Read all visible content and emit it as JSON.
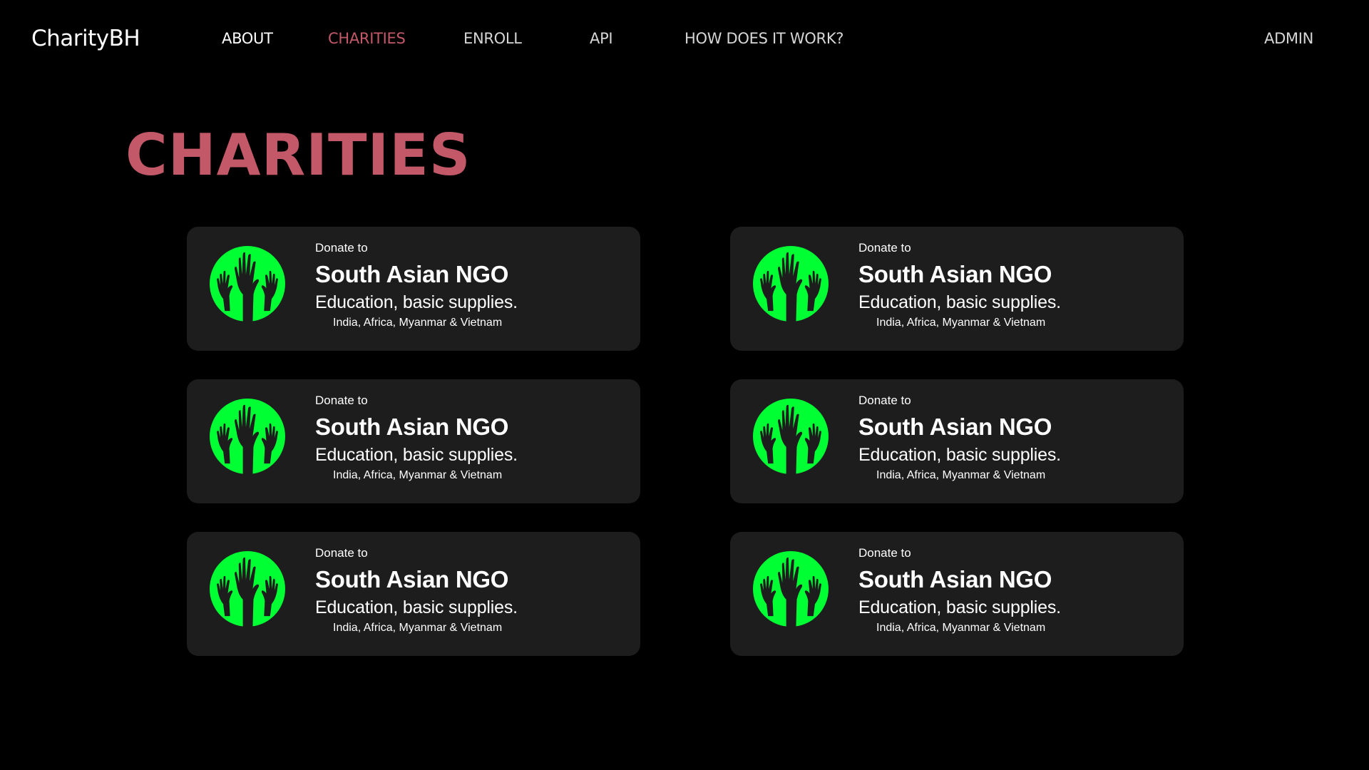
{
  "header": {
    "brand": "CharityBH",
    "nav": [
      {
        "label": "ABOUT"
      },
      {
        "label": "CHARITIES"
      },
      {
        "label": "ENROLL"
      },
      {
        "label": "API"
      },
      {
        "label": "HOW DOES IT WORK?"
      }
    ],
    "admin_label": "ADMIN",
    "active_item": "CHARITIES"
  },
  "page": {
    "title": "CHARITIES"
  },
  "colors": {
    "background": "#000000",
    "accent": "#c25868",
    "card_background": "#1d1d1d",
    "logo_green": "#00ff33"
  },
  "charities": [
    {
      "icon": "raised-hands-icon",
      "donate_label": "Donate to",
      "name": "South Asian NGO",
      "cause": "Education, basic supplies.",
      "regions": "India, Africa, Myanmar & Vietnam"
    },
    {
      "icon": "raised-hands-icon",
      "donate_label": "Donate to",
      "name": "South Asian NGO",
      "cause": "Education, basic supplies.",
      "regions": "India, Africa, Myanmar & Vietnam"
    },
    {
      "icon": "raised-hands-icon",
      "donate_label": "Donate to",
      "name": "South Asian NGO",
      "cause": "Education, basic supplies.",
      "regions": "India, Africa, Myanmar & Vietnam"
    },
    {
      "icon": "raised-hands-icon",
      "donate_label": "Donate to",
      "name": "South Asian NGO",
      "cause": "Education, basic supplies.",
      "regions": "India, Africa, Myanmar & Vietnam"
    },
    {
      "icon": "raised-hands-icon",
      "donate_label": "Donate to",
      "name": "South Asian NGO",
      "cause": "Education, basic supplies.",
      "regions": "India, Africa, Myanmar & Vietnam"
    },
    {
      "icon": "raised-hands-icon",
      "donate_label": "Donate to",
      "name": "South Asian NGO",
      "cause": "Education, basic supplies.",
      "regions": "India, Africa, Myanmar & Vietnam"
    }
  ]
}
